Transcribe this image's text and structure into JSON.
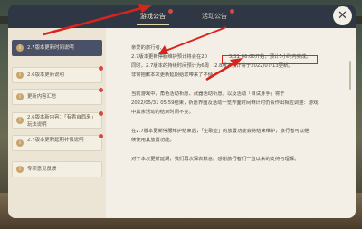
{
  "tabs": [
    {
      "label": "游戏公告",
      "active": true
    },
    {
      "label": "活动公告",
      "active": false
    }
  ],
  "sidebar": [
    {
      "label": "2.7版本更新时间说明",
      "active": true,
      "icon": "info-icon",
      "badge": false
    },
    {
      "label": "2.6版本更新说明",
      "active": false,
      "icon": "info-icon",
      "badge": true
    },
    {
      "label": "更新内容汇总",
      "active": false,
      "icon": "info-icon",
      "badge": true
    },
    {
      "label": "2.6版本新内容：「有香自西来」玩法说明",
      "active": false,
      "icon": "info-icon",
      "badge": true
    },
    {
      "label": "2.7版本更新延期补偿说明",
      "active": false,
      "icon": "info-icon",
      "badge": true
    },
    {
      "label": "专项意见反馈",
      "active": false,
      "icon": "info-icon",
      "badge": false
    }
  ],
  "content": {
    "greeting": "亲爱的旅行者,",
    "p1a": "2.7版本更新停服维护预计将会在20",
    "p1b": "5/31 06:00开始，预计5小时内完成。",
    "p2": "同时，2.7版本的持续时间预计为6周",
    "p2b": "2.8版本预计将于2022/07/13更新。",
    "p3": "非常抱歉本次更新延期给您带来了不便。",
    "p4": "当前游戏中，角色活动祈愿、武器活动祈愿，以及活动「目试身手」将于",
    "p5": "2022/05/31 05:59结束，祈愿界面及活动一览界面时间倒计时仍会作出相应调整：游戏",
    "p6": "中其余活动的结束时间不变。",
    "p7": "在2.7版本更新停服维护结束后，「尘歌壶」的放置功能会将结束维护，旅行者可以继",
    "p8": "续使用其放置功能。",
    "p9": "对于本次更新延期，我们再次深表歉意。感谢旅行者们一直以来的支持与理解。"
  },
  "colors": {
    "highlight": "#d8241d",
    "tab_bg": "#2f3644",
    "sidebar_active": "#4a5166"
  },
  "close_icon": "close-icon"
}
